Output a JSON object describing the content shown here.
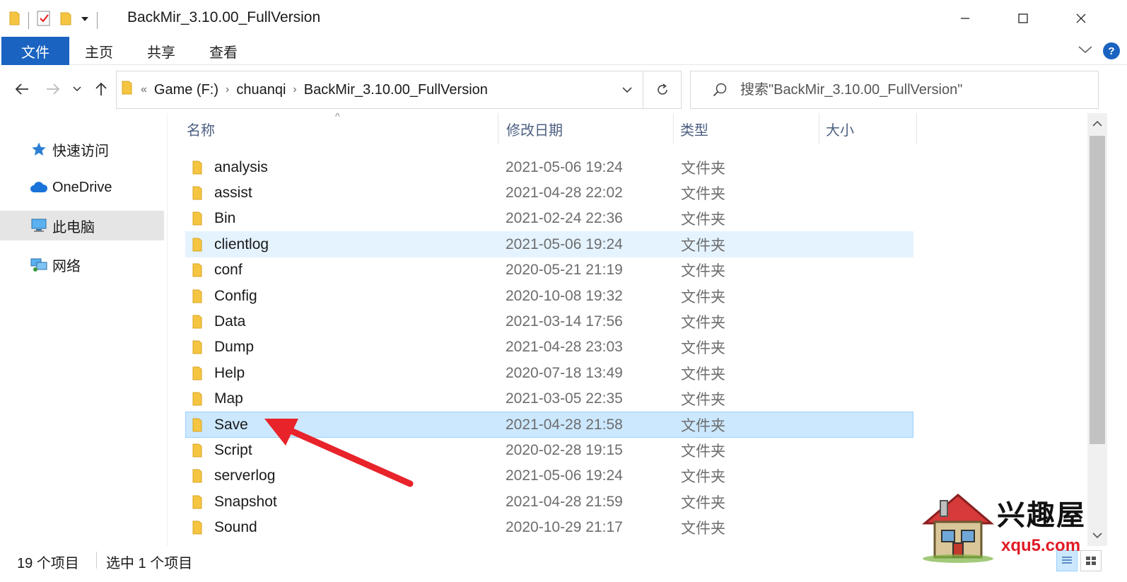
{
  "window": {
    "title": "BackMir_3.10.00_FullVersion",
    "controls": {
      "minimize": "—",
      "maximize": "☐",
      "close": "✕"
    }
  },
  "ribbon": {
    "tabs": [
      {
        "label": "文件",
        "active": true
      },
      {
        "label": "主页"
      },
      {
        "label": "共享"
      },
      {
        "label": "查看"
      }
    ],
    "help": "?"
  },
  "nav": {
    "breadcrumb_prefix": "«",
    "path": [
      "Game (F:)",
      "chuanqi",
      "BackMir_3.10.00_FullVersion"
    ],
    "crumb_sep": "›",
    "search_placeholder": "搜索\"BackMir_3.10.00_FullVersion\""
  },
  "sidebar": {
    "items": [
      {
        "label": "快速访问",
        "icon": "star-icon"
      },
      {
        "label": "OneDrive",
        "icon": "cloud-icon"
      },
      {
        "label": "此电脑",
        "icon": "computer-icon",
        "selected": true
      },
      {
        "label": "网络",
        "icon": "network-icon"
      }
    ]
  },
  "columns": {
    "name": "名称",
    "date": "修改日期",
    "type": "类型",
    "size": "大小",
    "sort_indicator": "^"
  },
  "files": [
    {
      "name": "analysis",
      "date": "2021-05-06 19:24",
      "type": "文件夹"
    },
    {
      "name": "assist",
      "date": "2021-04-28 22:02",
      "type": "文件夹"
    },
    {
      "name": "Bin",
      "date": "2021-02-24 22:36",
      "type": "文件夹"
    },
    {
      "name": "clientlog",
      "date": "2021-05-06 19:24",
      "type": "文件夹",
      "state": "hover"
    },
    {
      "name": "conf",
      "date": "2020-05-21 21:19",
      "type": "文件夹"
    },
    {
      "name": "Config",
      "date": "2020-10-08 19:32",
      "type": "文件夹"
    },
    {
      "name": "Data",
      "date": "2021-03-14 17:56",
      "type": "文件夹"
    },
    {
      "name": "Dump",
      "date": "2021-04-28 23:03",
      "type": "文件夹"
    },
    {
      "name": "Help",
      "date": "2020-07-18 13:49",
      "type": "文件夹"
    },
    {
      "name": "Map",
      "date": "2021-03-05 22:35",
      "type": "文件夹"
    },
    {
      "name": "Save",
      "date": "2021-04-28 21:58",
      "type": "文件夹",
      "state": "selected"
    },
    {
      "name": "Script",
      "date": "2020-02-28 19:15",
      "type": "文件夹"
    },
    {
      "name": "serverlog",
      "date": "2021-05-06 19:24",
      "type": "文件夹"
    },
    {
      "name": "Snapshot",
      "date": "2021-04-28 21:59",
      "type": "文件夹"
    },
    {
      "name": "Sound",
      "date": "2020-10-29 21:17",
      "type": "文件夹"
    }
  ],
  "status": {
    "item_count": "19 个项目",
    "selected": "选中 1 个项目"
  },
  "watermark": {
    "text": "兴趣屋",
    "url": "xqu5.com"
  },
  "colors": {
    "accent": "#1a63c1",
    "selected_row": "#cce8ff",
    "hover_row": "#e5f3ff",
    "folder": "#f5c542",
    "arrow": "#e8232a"
  }
}
